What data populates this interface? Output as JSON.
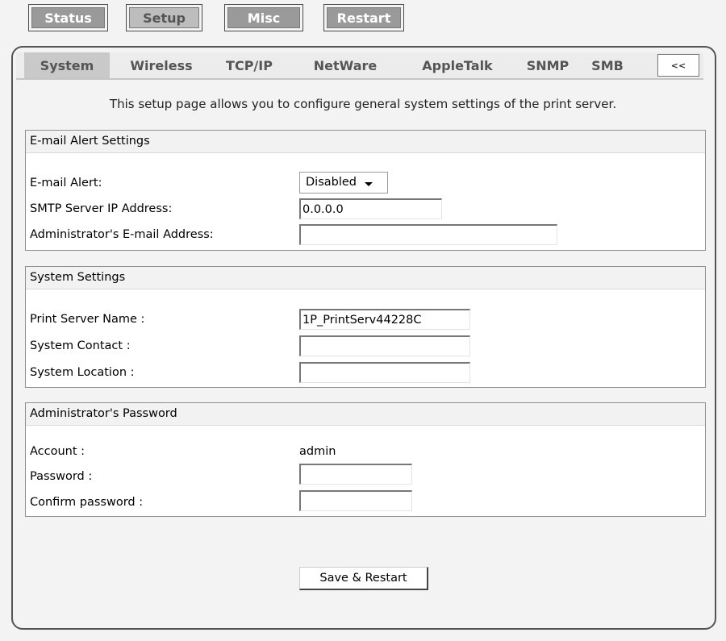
{
  "top_nav": {
    "status": "Status",
    "setup": "Setup",
    "misc": "Misc",
    "restart": "Restart",
    "active": "Setup"
  },
  "tabs": {
    "system": "System",
    "wireless": "Wireless",
    "tcpip": "TCP/IP",
    "netware": "NetWare",
    "appletalk": "AppleTalk",
    "snmp": "SNMP",
    "smb": "SMB",
    "back": "<<",
    "active": "System"
  },
  "intro": "This setup page allows you to configure general system settings of the print server.",
  "email_alert": {
    "header": "E-mail Alert Settings",
    "alert_label": "E-mail Alert:",
    "alert_value": "Disabled",
    "smtp_label": "SMTP Server IP Address:",
    "smtp_value": "0.0.0.0",
    "admin_email_label": "Administrator's E-mail Address:",
    "admin_email_value": ""
  },
  "system_settings": {
    "header": "System Settings",
    "server_name_label": "Print Server Name :",
    "server_name_value": "1P_PrintServ44228C",
    "contact_label": "System Contact :",
    "contact_value": "",
    "location_label": "System Location :",
    "location_value": ""
  },
  "admin_password": {
    "header": "Administrator's Password",
    "account_label": "Account :",
    "account_value": "admin",
    "password_label": "Password :",
    "password_value": "",
    "confirm_label": "Confirm password :",
    "confirm_value": ""
  },
  "save_button": "Save & Restart",
  "colors": {
    "page_bg": "#f3f3f3",
    "button_gray": "#9a9a9a",
    "active_tab": "#c9c9c9",
    "section_header_bg": "#f2f2f2"
  }
}
